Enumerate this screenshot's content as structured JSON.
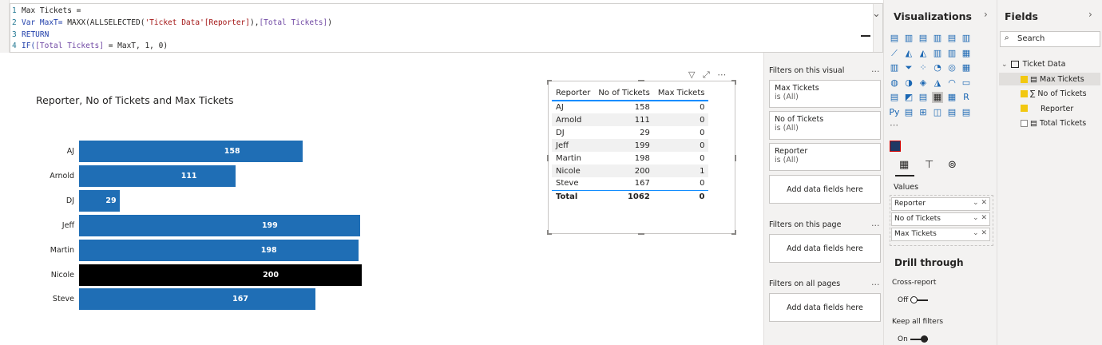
{
  "formula": {
    "lines": [
      {
        "num": "1",
        "text": "Max Tickets ="
      },
      {
        "num": "2",
        "pre": "Var MaxT= ",
        "fn": "MAXX(ALLSELECTED(",
        "str": "'Ticket Data'[Reporter]",
        "post": "),",
        "meas": "[Total Tickets]",
        "end": ")"
      },
      {
        "num": "3",
        "text": "RETURN"
      },
      {
        "num": "4",
        "pre": "IF(",
        "meas": "[Total Tickets]",
        "mid": " = MaxT, 1, 0)"
      }
    ]
  },
  "chart_data": {
    "type": "bar",
    "orientation": "horizontal",
    "title": "Reporter, No of Tickets and Max Tickets",
    "categories": [
      "AJ",
      "Arnold",
      "DJ",
      "Jeff",
      "Martin",
      "Nicole",
      "Steve"
    ],
    "values": [
      158,
      111,
      29,
      199,
      198,
      200,
      167
    ],
    "highlight_index": 5,
    "colors": {
      "default": "#1f6eb5",
      "highlight": "#000000"
    },
    "xlim": [
      0,
      200
    ]
  },
  "table": {
    "headers": [
      "Reporter",
      "No of Tickets",
      "Max Tickets"
    ],
    "rows": [
      [
        "AJ",
        "158",
        "0"
      ],
      [
        "Arnold",
        "111",
        "0"
      ],
      [
        "DJ",
        "29",
        "0"
      ],
      [
        "Jeff",
        "199",
        "0"
      ],
      [
        "Martin",
        "198",
        "0"
      ],
      [
        "Nicole",
        "200",
        "1"
      ],
      [
        "Steve",
        "167",
        "0"
      ]
    ],
    "total": [
      "Total",
      "1062",
      "0"
    ]
  },
  "filters": {
    "on_visual_title": "Filters on this visual",
    "cards": [
      {
        "name": "Max Tickets",
        "state": "is (All)"
      },
      {
        "name": "No of Tickets",
        "state": "is (All)"
      },
      {
        "name": "Reporter",
        "state": "is (All)"
      }
    ],
    "add_fields": "Add data fields here",
    "on_page_title": "Filters on this page",
    "all_pages_title": "Filters on all pages",
    "more": "..."
  },
  "visualizations": {
    "title": "Visualizations",
    "values_label": "Values",
    "wells": [
      "Reporter",
      "No of Tickets",
      "Max Tickets"
    ],
    "drill_title": "Drill through",
    "cross_report": "Cross-report",
    "cross_state": "Off",
    "keep_filters": "Keep all filters",
    "keep_state": "On"
  },
  "fields": {
    "title": "Fields",
    "search_placeholder": "Search",
    "table_name": "Ticket Data",
    "items": [
      {
        "name": "Max Tickets",
        "checked": true
      },
      {
        "name": "No of Tickets",
        "checked": true
      },
      {
        "name": "Reporter",
        "checked": true
      },
      {
        "name": "Total Tickets",
        "checked": false
      }
    ]
  }
}
